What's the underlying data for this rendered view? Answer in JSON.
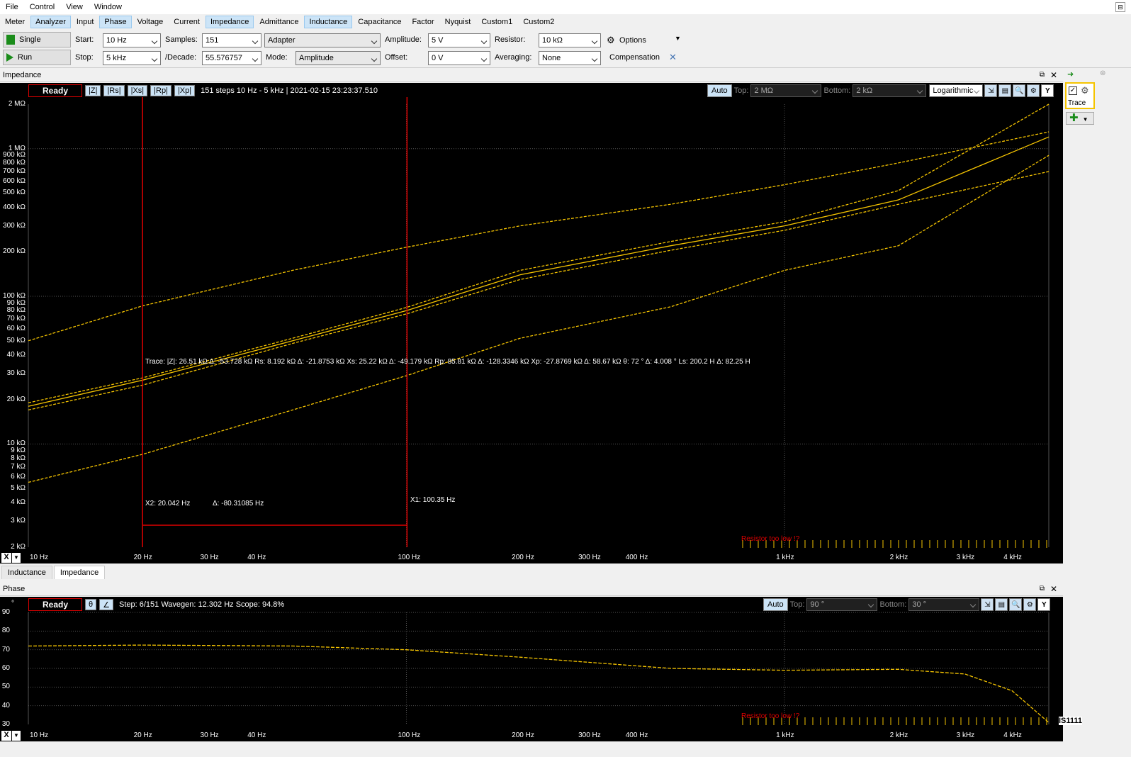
{
  "menu": [
    "File",
    "Control",
    "View",
    "Window"
  ],
  "tabs": [
    {
      "label": "Meter",
      "active": false
    },
    {
      "label": "Analyzer",
      "active": true
    },
    {
      "label": "Input",
      "active": false
    },
    {
      "label": "Phase",
      "active": true
    },
    {
      "label": "Voltage",
      "active": false
    },
    {
      "label": "Current",
      "active": false
    },
    {
      "label": "Impedance",
      "active": true
    },
    {
      "label": "Admittance",
      "active": false
    },
    {
      "label": "Inductance",
      "active": true
    },
    {
      "label": "Capacitance",
      "active": false
    },
    {
      "label": "Factor",
      "active": false
    },
    {
      "label": "Nyquist",
      "active": false
    },
    {
      "label": "Custom1",
      "active": false
    },
    {
      "label": "Custom2",
      "active": false
    }
  ],
  "toolbar": {
    "single_label": "Single",
    "run_label": "Run",
    "start_label": "Start:",
    "start_value": "10 Hz",
    "stop_label": "Stop:",
    "stop_value": "5 kHz",
    "samples_label": "Samples:",
    "samples_value": "151",
    "decade_label": "/Decade:",
    "decade_value": "55.576757",
    "adapter_value": "Adapter",
    "mode_label": "Mode:",
    "mode_value": "Amplitude",
    "amplitude_label": "Amplitude:",
    "amplitude_value": "5 V",
    "offset_label": "Offset:",
    "offset_value": "0 V",
    "resistor_label": "Resistor:",
    "resistor_value": "10 kΩ",
    "averaging_label": "Averaging:",
    "averaging_value": "None",
    "options_label": "Options",
    "compensation_label": "Compensation"
  },
  "impedance": {
    "title": "Impedance",
    "ready": "Ready",
    "chips": [
      "|Z|",
      "|Rs|",
      "|Xs|",
      "|Rp|",
      "|Xp|"
    ],
    "status": "151 steps 10 Hz - 5 kHz | 2021-02-15 23:23:37.510",
    "auto": "Auto",
    "top_label": "Top:",
    "top_value": "2 MΩ",
    "bottom_label": "Bottom:",
    "bottom_value": "2 kΩ",
    "scale": "Logarithmic",
    "y_btn": "Y",
    "yticks": [
      "2 MΩ",
      "1 MΩ",
      "900 kΩ",
      "800 kΩ",
      "700 kΩ",
      "600 kΩ",
      "500 kΩ",
      "400 kΩ",
      "300 kΩ",
      "200 kΩ",
      "100 kΩ",
      "90 kΩ",
      "80 kΩ",
      "70 kΩ",
      "60 kΩ",
      "50 kΩ",
      "40 kΩ",
      "30 kΩ",
      "20 kΩ",
      "10 kΩ",
      "9 kΩ",
      "8 kΩ",
      "7 kΩ",
      "6 kΩ",
      "5 kΩ",
      "4 kΩ",
      "3 kΩ",
      "2 kΩ"
    ],
    "xticks": [
      "10 Hz",
      "20 Hz",
      "30 Hz",
      "40 Hz",
      "100 Hz",
      "200 Hz",
      "300 Hz",
      "400 Hz",
      "1 kHz",
      "2 kHz",
      "3 kHz",
      "4 kHz"
    ],
    "trace_readout": "Trace:      |Z|: 26.51 kΩ Δ: -53.728 kΩ  Rs: 8.192 kΩ Δ: -21.8753 kΩ  Xs: 25.22 kΩ Δ: -49.179 kΩ  Rp: 85.81 kΩ Δ: -128.3346 kΩ  Xp: -27.8769 kΩ Δ: 58.67 kΩ  θ: 72 ° Δ: 4.008 °  Ls: 200.2 H Δ: 82.25 H",
    "x2_label": "X2: 20.042 Hz",
    "delta_label": "Δ: -80.31085 Hz",
    "x1_label": "X1: 100.35 Hz",
    "warning": "Resistor too low !?",
    "x_btn": "X"
  },
  "bottom_tabs": [
    {
      "label": "Inductance",
      "active": false
    },
    {
      "label": "Impedance",
      "active": true
    }
  ],
  "phase": {
    "title": "Phase",
    "ready": "Ready",
    "chips": [
      "θ",
      "∠"
    ],
    "status": "Step: 6/151 Wavegen: 12.302 Hz  Scope: 94.8%",
    "auto": "Auto",
    "top_label": "Top:",
    "top_value": "90 °",
    "bottom_label": "Bottom:",
    "bottom_value": "30 °",
    "y_btn": "Y",
    "unit": "°",
    "yticks": [
      "90",
      "80",
      "70",
      "60",
      "50",
      "40",
      "30"
    ],
    "xticks": [
      "10 Hz",
      "20 Hz",
      "30 Hz",
      "40 Hz",
      "100 Hz",
      "200 Hz",
      "300 Hz",
      "400 Hz",
      "1 kHz",
      "2 kHz",
      "3 kHz",
      "4 kHz"
    ],
    "warning": "Resistor too low !?",
    "x_btn": "X"
  },
  "dock": {
    "trace_label": "Trace",
    "watermark": "IS1111"
  },
  "colors": {
    "trace": "#f5c400",
    "cursor": "#e00000",
    "grid": "#555555"
  },
  "chart_data": [
    {
      "type": "line",
      "title": "Impedance",
      "xscale": "log",
      "yscale": "log",
      "xlim": [
        10,
        5000
      ],
      "ylim": [
        2000,
        2000000
      ],
      "series": [
        {
          "name": "|Z|",
          "x": [
            10,
            20,
            50,
            100,
            200,
            500,
            1000,
            2000,
            5000
          ],
          "y": [
            18000,
            27000,
            50000,
            80000,
            140000,
            220000,
            300000,
            450000,
            1200000
          ]
        },
        {
          "name": "|Rs|",
          "x": [
            10,
            20,
            50,
            100,
            200,
            500,
            1000,
            2000,
            5000
          ],
          "y": [
            5500,
            8500,
            17000,
            29000,
            52000,
            85000,
            150000,
            220000,
            900000
          ]
        },
        {
          "name": "|Xs|",
          "x": [
            10,
            20,
            50,
            100,
            200,
            500,
            1000,
            2000,
            5000
          ],
          "y": [
            17000,
            25000,
            48000,
            76000,
            130000,
            205000,
            280000,
            420000,
            700000
          ]
        },
        {
          "name": "|Rp|",
          "x": [
            10,
            20,
            50,
            100,
            200,
            500,
            1000,
            2000,
            5000
          ],
          "y": [
            50000,
            86000,
            150000,
            215000,
            300000,
            420000,
            570000,
            800000,
            1300000
          ]
        },
        {
          "name": "|Xp|",
          "x": [
            10,
            20,
            50,
            100,
            200,
            500,
            1000,
            2000,
            5000
          ],
          "y": [
            19000,
            28000,
            52000,
            84000,
            150000,
            235000,
            320000,
            520000,
            2000000
          ]
        }
      ]
    },
    {
      "type": "line",
      "title": "Phase",
      "xscale": "log",
      "xlim": [
        10,
        5000
      ],
      "ylim": [
        30,
        90
      ],
      "series": [
        {
          "name": "θ",
          "x": [
            10,
            20,
            50,
            100,
            200,
            500,
            1000,
            2000,
            3000,
            4000,
            5000
          ],
          "y": [
            72,
            72.5,
            72,
            70,
            66,
            60,
            59,
            59.5,
            57,
            48,
            31
          ]
        }
      ]
    }
  ]
}
